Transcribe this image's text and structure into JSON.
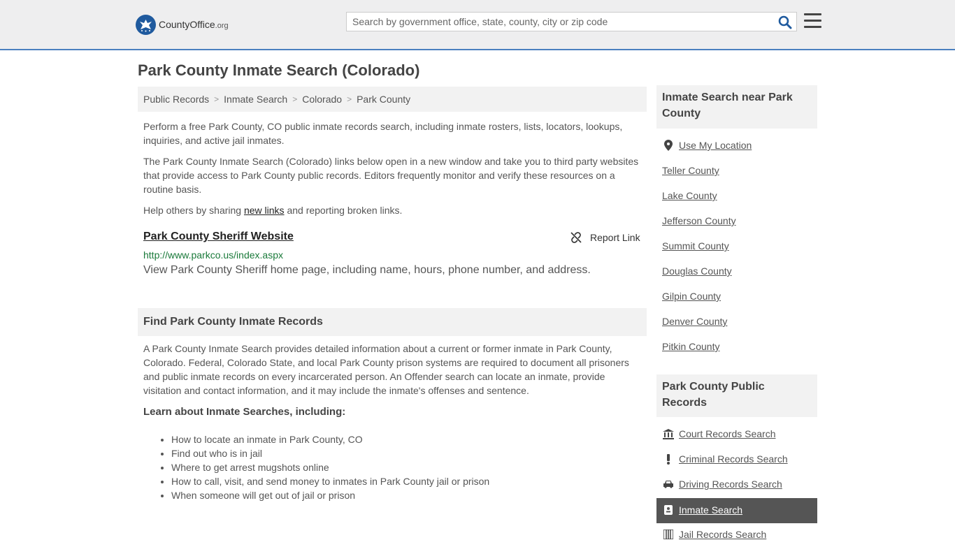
{
  "header": {
    "logo_main": "CountyOffice",
    "logo_tld": ".org",
    "search_placeholder": "Search by government office, state, county, city or zip code"
  },
  "page_title": "Park County Inmate Search (Colorado)",
  "breadcrumb": [
    "Public Records",
    "Inmate Search",
    "Colorado",
    "Park County"
  ],
  "intro": {
    "p1": "Perform a free Park County, CO public inmate records search, including inmate rosters, lists, locators, lookups, inquiries, and active jail inmates.",
    "p2": "The Park County Inmate Search (Colorado) links below open in a new window and take you to third party websites that provide access to Park County public records. Editors frequently monitor and verify these resources on a routine basis.",
    "p3_before": "Help others by sharing ",
    "p3_link": "new links",
    "p3_after": " and reporting broken links."
  },
  "listing": {
    "title": "Park County Sheriff Website",
    "report_label": "Report Link",
    "url": "http://www.parkco.us/index.aspx",
    "description": "View Park County Sheriff home page, including name, hours, phone number, and address."
  },
  "find_section": {
    "heading": "Find Park County Inmate Records",
    "body": "A Park County Inmate Search provides detailed information about a current or former inmate in Park County, Colorado. Federal, Colorado State, and local Park County prison systems are required to document all prisoners and public inmate records on every incarcerated person. An Offender search can locate an inmate, provide visitation and contact information, and it may include the inmate's offenses and sentence.",
    "learn_heading": "Learn about Inmate Searches, including:",
    "bullets": [
      "How to locate an inmate in Park County, CO",
      "Find out who is in jail",
      "Where to get arrest mugshots online",
      "How to call, visit, and send money to inmates in Park County jail or prison",
      "When someone will get out of jail or prison"
    ]
  },
  "sidebar": {
    "nearby_heading": "Inmate Search near Park County",
    "use_location": "Use My Location",
    "nearby": [
      "Teller County",
      "Lake County",
      "Jefferson County",
      "Summit County",
      "Douglas County",
      "Gilpin County",
      "Denver County",
      "Pitkin County"
    ],
    "records_heading": "Park County Public Records",
    "records": [
      {
        "label": "Court Records Search",
        "icon": "courthouse-icon"
      },
      {
        "label": "Criminal Records Search",
        "icon": "exclamation-icon"
      },
      {
        "label": "Driving Records Search",
        "icon": "car-icon"
      },
      {
        "label": "Inmate Search",
        "icon": "id-badge-icon",
        "active": true
      },
      {
        "label": "Jail Records Search",
        "icon": "jail-icon"
      }
    ]
  },
  "colors": {
    "header_bg": "#eeeeef",
    "brand_blue": "#1f5a9e",
    "url_green": "#1a7a3a",
    "active_bg": "#555555"
  }
}
